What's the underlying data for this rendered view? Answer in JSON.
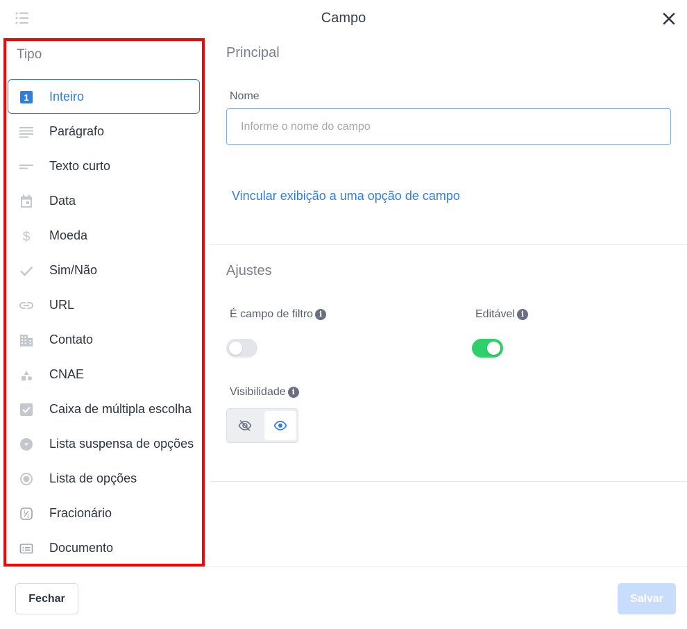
{
  "header": {
    "title": "Campo",
    "list_icon": "list-icon",
    "close_icon": "close-icon"
  },
  "type_panel": {
    "title": "Tipo",
    "items": [
      {
        "label": "Inteiro",
        "icon": "number-one-icon",
        "selected": true
      },
      {
        "label": "Parágrafo",
        "icon": "paragraph-icon",
        "selected": false
      },
      {
        "label": "Texto curto",
        "icon": "short-text-icon",
        "selected": false
      },
      {
        "label": "Data",
        "icon": "calendar-icon",
        "selected": false
      },
      {
        "label": "Moeda",
        "icon": "dollar-icon",
        "selected": false
      },
      {
        "label": "Sim/Não",
        "icon": "check-icon",
        "selected": false
      },
      {
        "label": "URL",
        "icon": "link-icon",
        "selected": false
      },
      {
        "label": "Contato",
        "icon": "building-icon",
        "selected": false
      },
      {
        "label": "CNAE",
        "icon": "shapes-icon",
        "selected": false
      },
      {
        "label": "Caixa de múltipla escolha",
        "icon": "checkbox-icon",
        "selected": false
      },
      {
        "label": "Lista suspensa de opções",
        "icon": "dropdown-circle-icon",
        "selected": false
      },
      {
        "label": "Lista de opções",
        "icon": "radio-icon",
        "selected": false
      },
      {
        "label": "Fracionário",
        "icon": "fraction-icon",
        "selected": false
      },
      {
        "label": "Documento",
        "icon": "document-card-icon",
        "selected": false
      }
    ]
  },
  "principal": {
    "title": "Principal",
    "name_label": "Nome",
    "name_value": "",
    "name_placeholder": "Informe o nome do campo",
    "link_label": "Vincular exibição a uma opção de campo"
  },
  "ajustes": {
    "title": "Ajustes",
    "filter_label": "É campo de filtro",
    "filter_enabled": false,
    "editable_label": "Editável",
    "editable_enabled": true,
    "visibility_label": "Visibilidade",
    "visibility_value": "visible",
    "info_icon": "i"
  },
  "footer": {
    "close_label": "Fechar",
    "save_label": "Salvar"
  },
  "colors": {
    "accent": "#2f7de1",
    "toggle_on": "#2fcf6a",
    "highlight_border": "#ff0000",
    "save_disabled": "#c8dcfb"
  }
}
